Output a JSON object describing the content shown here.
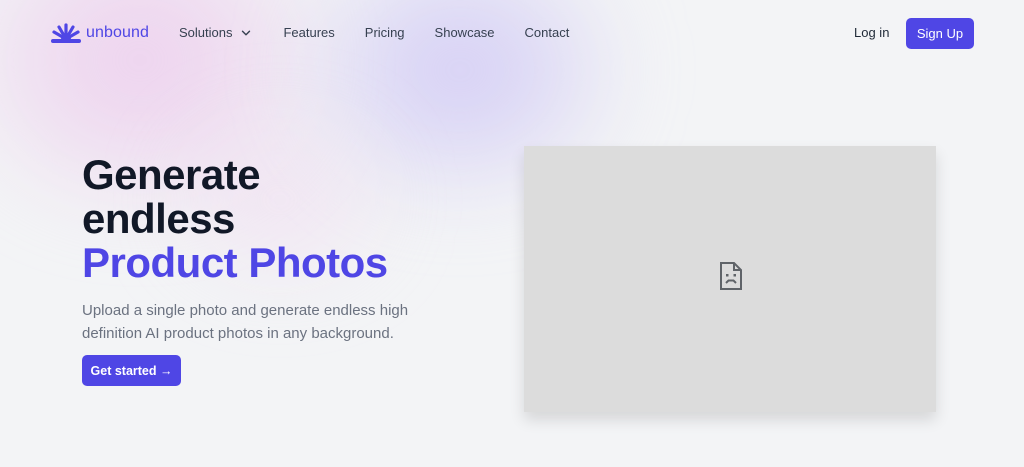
{
  "brand": {
    "name": "unbound",
    "icon": "sunrise-logo-icon",
    "color": "#4f46e5"
  },
  "nav": {
    "items": [
      {
        "label": "Solutions",
        "has_dropdown": true,
        "icon": "chevron-down-icon"
      },
      {
        "label": "Features"
      },
      {
        "label": "Pricing"
      },
      {
        "label": "Showcase"
      },
      {
        "label": "Contact"
      }
    ],
    "login_label": "Log in",
    "signup_label": "Sign Up"
  },
  "hero": {
    "title_line1": "Generate",
    "title_line2": "endless",
    "title_accent": "Product Photos",
    "subtitle": "Upload a single photo and generate endless high definition AI product photos in any background.",
    "cta_label": "Get started →"
  },
  "media": {
    "icon": "broken-image-icon"
  },
  "colors": {
    "accent": "#4f46e5",
    "heading": "#111827",
    "muted": "#6b7280",
    "background": "#f3f4f6",
    "placeholder": "#dcdcdc"
  }
}
